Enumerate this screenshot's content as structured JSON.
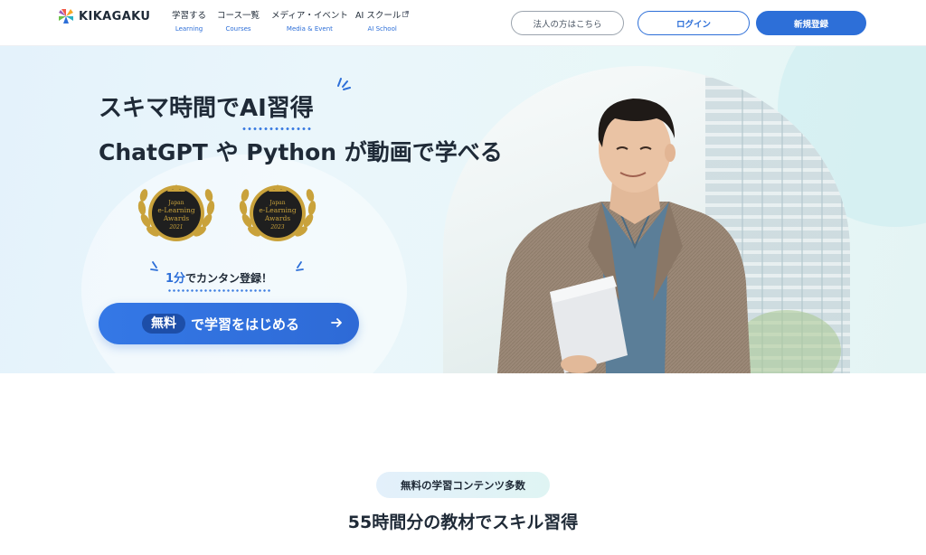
{
  "brand": {
    "name": "KIKAGAKU"
  },
  "nav": [
    {
      "label": "学習する",
      "sub": "Learning"
    },
    {
      "label": "コース一覧",
      "sub": "Courses"
    },
    {
      "label": "メディア・イベント",
      "sub": "Media & Event"
    },
    {
      "label": "AI スクール",
      "sub": "AI School",
      "icon": "external-link-icon"
    }
  ],
  "header_buttons": {
    "corporate": "法人の方はこちら",
    "login": "ログイン",
    "register": "新規登録"
  },
  "hero": {
    "title_prefix": "スキマ時間で",
    "title_highlight": "AI習得",
    "subtitle": "ChatGPT や Python が動画で学べる",
    "awards": [
      {
        "line1": "Japan",
        "line2": "e-Learning",
        "line3": "Awards",
        "year": "2021"
      },
      {
        "line1": "Japan",
        "line2": "e-Learning",
        "line3": "Awards",
        "year": "2023"
      }
    ],
    "signup_num": "1分",
    "signup_text": "でカンタン登録！",
    "cta_badge": "無料",
    "cta_text": "で学習をはじめる",
    "cta_icon": "arrow-right-icon"
  },
  "section": {
    "pill": "無料の学習コンテンツ多数",
    "title": "55時間分の教材でスキル習得"
  },
  "colors": {
    "accent": "#2d6fd8",
    "text": "#1f2a37",
    "award_gold": "#c9a23b",
    "award_dark": "#1f1f1f"
  }
}
